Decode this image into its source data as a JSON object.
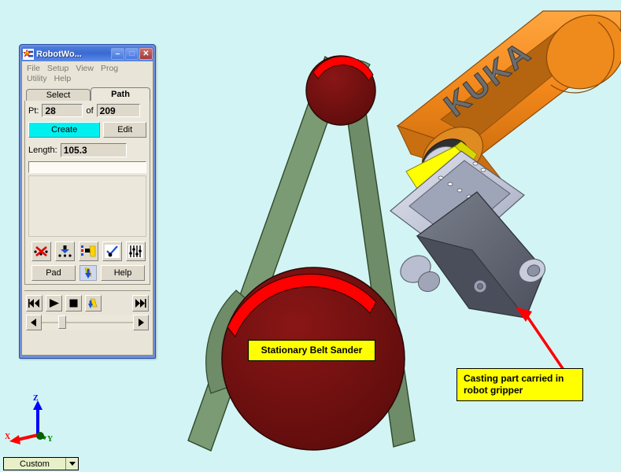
{
  "app": {
    "window_title": "RobotWo...",
    "icon": "robotworks-logo-icon",
    "window_buttons": {
      "minimize": "–",
      "maximize": "□",
      "close": "✕"
    },
    "menu": {
      "row1": [
        "File",
        "Setup",
        "View",
        "Prog"
      ],
      "row2": [
        "Utility",
        "Help"
      ]
    },
    "tabs": [
      {
        "label": "Select",
        "active": false
      },
      {
        "label": "Path",
        "active": true
      }
    ],
    "point": {
      "prefix_label": "Pt:",
      "current": "28",
      "of_label": "of",
      "total": "209"
    },
    "buttons": {
      "create": "Create",
      "edit": "Edit",
      "pad": "Pad",
      "help": "Help"
    },
    "length": {
      "label": "Length:",
      "value": "105.3"
    },
    "text_input_value": "",
    "icon_toolbar": [
      "delete-point-icon",
      "insert-point-icon",
      "move-to-point-icon",
      "check-point-icon",
      "point-settings-icon"
    ],
    "robot_jog_icon": "robot-jog-icon",
    "playback": [
      "rewind-to-start-icon",
      "play-icon",
      "stop-icon",
      "robot-simulate-icon",
      "forward-to-end-icon"
    ],
    "slider": {
      "left_arrow": "scroll-left-icon",
      "right_arrow": "scroll-right-icon",
      "position_percent": 18
    }
  },
  "viewport": {
    "background_color": "#d3f4f4",
    "annotations": [
      {
        "id": "stationary-belt-sander",
        "text": "Stationary Belt Sander",
        "bg": "#ffff00",
        "border": "#000000"
      },
      {
        "id": "casting-part",
        "text": "Casting part carried in\nrobot gripper",
        "bg": "#ffff00",
        "border": "#000000"
      }
    ],
    "robot": {
      "brand_text": "KUKA",
      "body_color": "#f08a1e",
      "body_shadow_color": "#c05a10",
      "brand_text_color": "#646464"
    },
    "belt_sander": {
      "belt_color": "#7a9a74",
      "belt_shadow_color": "#5d7a58",
      "pulley_color": "#700f0f",
      "pulley_highlight_color": "#ff0000"
    },
    "gripper": {
      "body_color": "#c3c7d8",
      "dark_color": "#5e626e",
      "accent_color": "#ffff00"
    },
    "pointer_arrow": {
      "color": "#ff0000",
      "name": "casting-callout-arrow"
    }
  },
  "axis_triad": {
    "x": {
      "label": "X",
      "color": "#ff0000"
    },
    "y": {
      "label": "Y",
      "color": "#008000"
    },
    "z": {
      "label": "Z",
      "color": "#0000ff"
    }
  },
  "view_dropdown": {
    "value": "Custom",
    "chevron": "chevron-down-icon"
  }
}
